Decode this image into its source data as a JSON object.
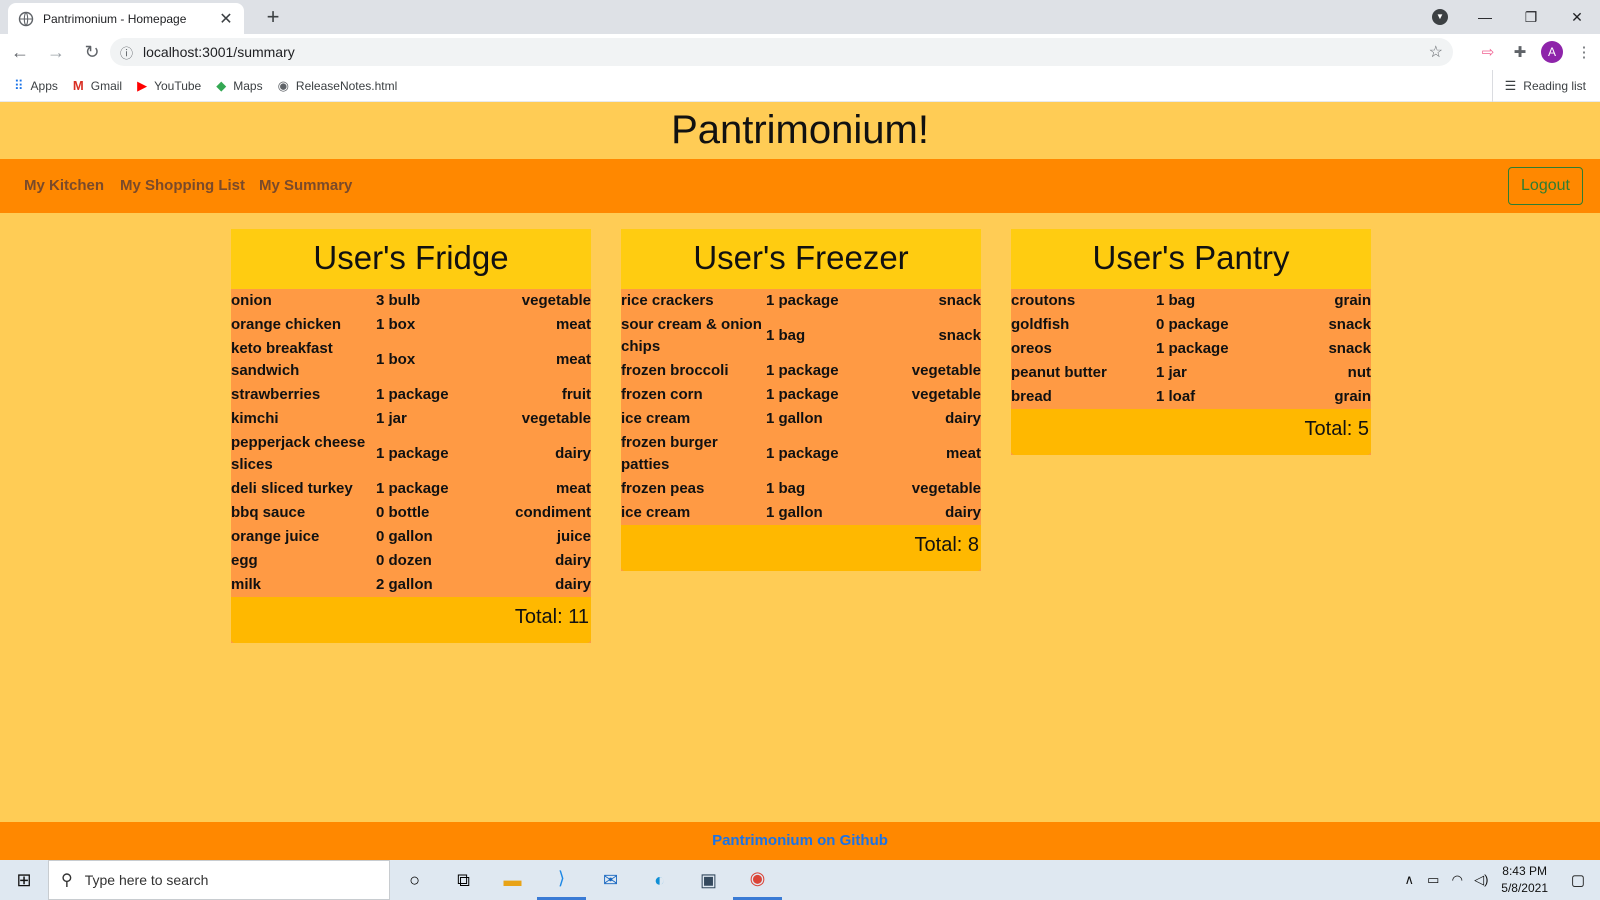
{
  "browser": {
    "tab_title": "Pantrimonium - Homepage",
    "url": "localhost:3001/summary",
    "bookmarks": [
      "Apps",
      "Gmail",
      "YouTube",
      "Maps",
      "ReleaseNotes.html"
    ],
    "reading_list": "Reading list",
    "avatar_letter": "A"
  },
  "site": {
    "title": "Pantrimonium!",
    "nav": [
      "My Kitchen",
      "My Shopping List",
      "My Summary"
    ],
    "logout": "Logout",
    "footer_link": "Pantrimonium on Github"
  },
  "cards": [
    {
      "title": "User's Fridge",
      "total": "Total: 11",
      "items": [
        {
          "name": "onion",
          "qty": "3 bulb",
          "cat": "vegetable"
        },
        {
          "name": "orange chicken",
          "qty": "1 box",
          "cat": "meat"
        },
        {
          "name": "keto breakfast sandwich",
          "qty": "1 box",
          "cat": "meat"
        },
        {
          "name": "strawberries",
          "qty": "1 package",
          "cat": "fruit"
        },
        {
          "name": "kimchi",
          "qty": "1 jar",
          "cat": "vegetable"
        },
        {
          "name": "pepperjack cheese slices",
          "qty": "1 package",
          "cat": "dairy"
        },
        {
          "name": "deli sliced turkey",
          "qty": "1 package",
          "cat": "meat"
        },
        {
          "name": "bbq sauce",
          "qty": "0 bottle",
          "cat": "condiment"
        },
        {
          "name": "orange juice",
          "qty": "0 gallon",
          "cat": "juice"
        },
        {
          "name": "egg",
          "qty": "0 dozen",
          "cat": "dairy"
        },
        {
          "name": "milk",
          "qty": "2 gallon",
          "cat": "dairy"
        }
      ]
    },
    {
      "title": "User's Freezer",
      "total": "Total: 8",
      "items": [
        {
          "name": "rice crackers",
          "qty": "1 package",
          "cat": "snack"
        },
        {
          "name": "sour cream & onion chips",
          "qty": "1 bag",
          "cat": "snack"
        },
        {
          "name": "frozen broccoli",
          "qty": "1 package",
          "cat": "vegetable"
        },
        {
          "name": "frozen corn",
          "qty": "1 package",
          "cat": "vegetable"
        },
        {
          "name": "ice cream",
          "qty": "1 gallon",
          "cat": "dairy"
        },
        {
          "name": "frozen burger patties",
          "qty": "1 package",
          "cat": "meat"
        },
        {
          "name": "frozen peas",
          "qty": "1 bag",
          "cat": "vegetable"
        },
        {
          "name": "ice cream",
          "qty": "1 gallon",
          "cat": "dairy"
        }
      ]
    },
    {
      "title": "User's Pantry",
      "total": "Total: 5",
      "items": [
        {
          "name": "croutons",
          "qty": "1 bag",
          "cat": "grain"
        },
        {
          "name": "goldfish",
          "qty": "0 package",
          "cat": "snack"
        },
        {
          "name": "oreos",
          "qty": "1 package",
          "cat": "snack"
        },
        {
          "name": "peanut butter",
          "qty": "1 jar",
          "cat": "nut"
        },
        {
          "name": "bread",
          "qty": "1 loaf",
          "cat": "grain"
        }
      ]
    }
  ],
  "taskbar": {
    "search_placeholder": "Type here to search",
    "time": "8:43 PM",
    "date": "5/8/2021"
  }
}
